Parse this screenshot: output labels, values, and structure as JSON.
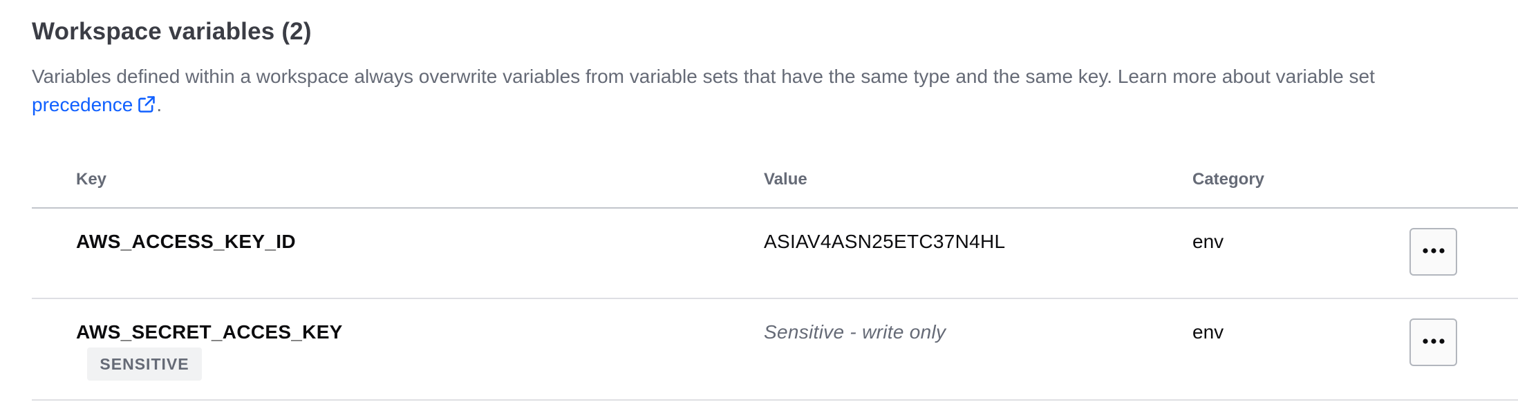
{
  "section": {
    "title": "Workspace variables (2)",
    "description_text": "Variables defined within a workspace always overwrite variables from variable sets that have the same type and the same key. Learn more about variable set",
    "link_text": "precedence",
    "trailing_punct": ".",
    "link_icon": "external-link-icon",
    "link_color": "#1060ff"
  },
  "table": {
    "headers": {
      "key": "Key",
      "value": "Value",
      "category": "Category"
    },
    "rows": [
      {
        "key": "AWS_ACCESS_KEY_ID",
        "value": "ASIAV4ASN25ETC37N4HL",
        "category": "env",
        "actions_icon": "more-horizontal-icon"
      },
      {
        "key": "AWS_SECRET_ACCES_KEY",
        "badge": "SENSITIVE",
        "value": "Sensitive - write only",
        "category": "env",
        "actions_icon": "more-horizontal-icon"
      }
    ]
  }
}
